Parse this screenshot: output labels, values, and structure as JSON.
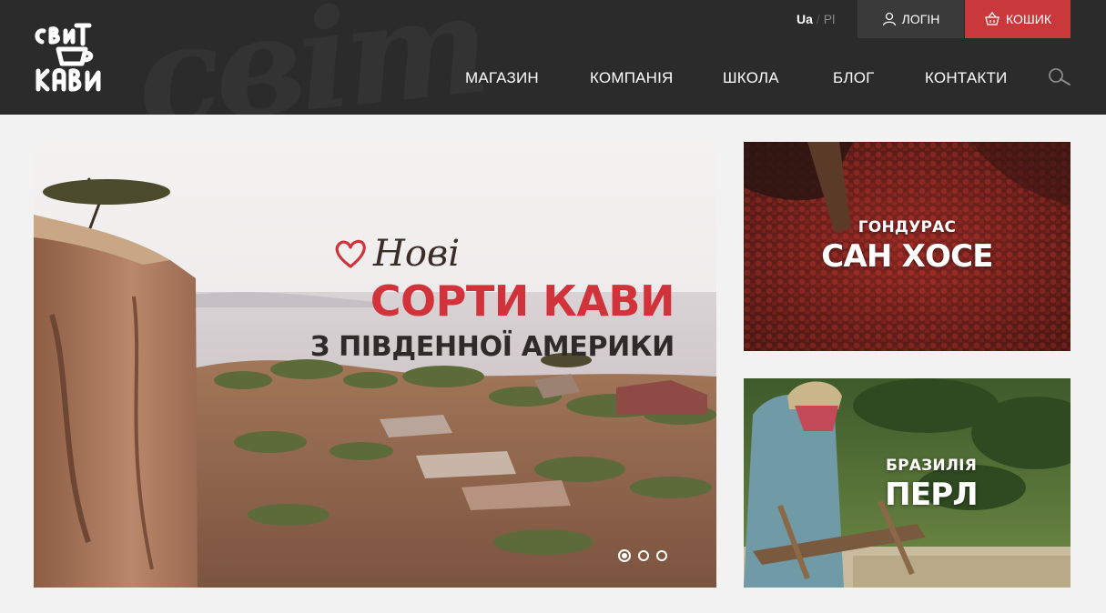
{
  "header": {
    "logo_alt": "Світ кави",
    "lang": {
      "active": "Ua",
      "separator": "/",
      "other": "Pl"
    },
    "login_label": "ЛОГІН",
    "cart_label": "КОШИК",
    "nav": [
      "МАГАЗИН",
      "КОМПАНІЯ",
      "ШКОЛА",
      "БЛОГ",
      "КОНТАКТИ"
    ],
    "search_icon": "search-icon"
  },
  "hero": {
    "line1": "Нові",
    "line2": "СОРТИ КАВИ",
    "line3": "З ПІВДЕННОЇ АМЕРИКИ",
    "slides_total": 3,
    "active_slide": 1
  },
  "tiles": [
    {
      "subtitle": "ГОНДУРАС",
      "title": "САН ХОСЕ"
    },
    {
      "subtitle": "БРАЗИЛІЯ",
      "title": "ПЕРЛ"
    }
  ],
  "colors": {
    "accent": "#c9383a",
    "header_bg": "#2b2b2b",
    "page_bg": "#f2f2f2"
  }
}
